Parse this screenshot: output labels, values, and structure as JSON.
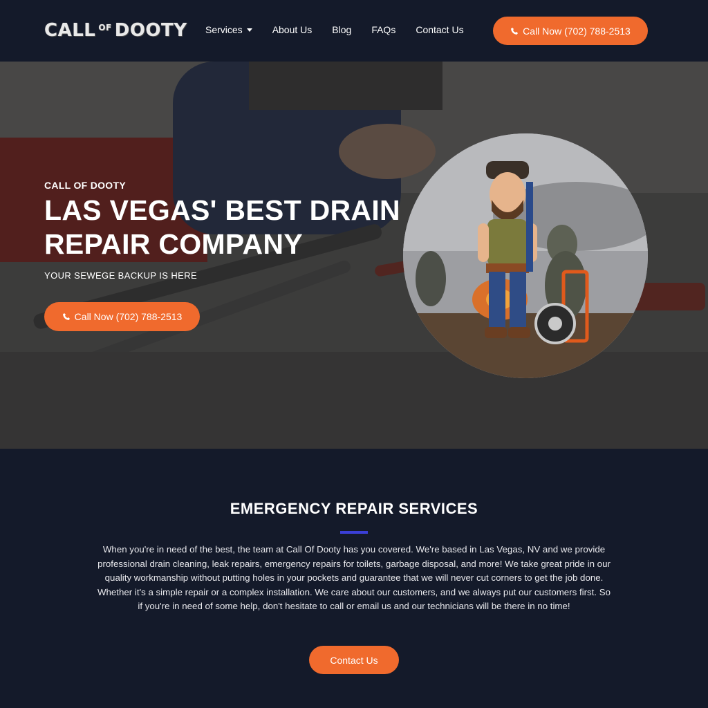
{
  "header": {
    "logo": {
      "part1": "CALL",
      "part2": "OF",
      "part3": "DOOTY"
    },
    "nav": [
      {
        "label": "Services",
        "has_dropdown": true
      },
      {
        "label": "About Us"
      },
      {
        "label": "Blog"
      },
      {
        "label": "FAQs"
      },
      {
        "label": "Contact Us"
      }
    ],
    "call_button": "Call Now (702) 788-2513"
  },
  "hero": {
    "eyebrow": "CALL OF DOOTY",
    "title": "LAS VEGAS' BEST DRAIN REPAIR COMPANY",
    "subtitle": "YOUR SEWEGE BACKUP IS HERE",
    "call_button": "Call Now (702) 788-2513"
  },
  "services": {
    "title": "EMERGENCY REPAIR SERVICES",
    "body": "When you're in need of the best, the team at Call Of Dooty has you covered.  We're based in Las Vegas, NV and we provide professional drain cleaning, leak repairs, emergency repairs for toilets, garbage disposal, and more! We take great pride in our quality workmanship without putting holes in your pockets and guarantee that we will never cut corners to get the job done. Whether it's a simple repair or a complex installation. We care about our customers, and we always put our customers first. So if you're in need of some help, don't hesitate to call or email us and our technicians will be there in no time!",
    "contact_button": "Contact Us"
  },
  "colors": {
    "accent": "#f06a2d",
    "navy": "#141a2a",
    "divider": "#3b3fd6"
  },
  "icons": {
    "phone": "phone-icon",
    "dropdown": "chevron-down-icon"
  }
}
